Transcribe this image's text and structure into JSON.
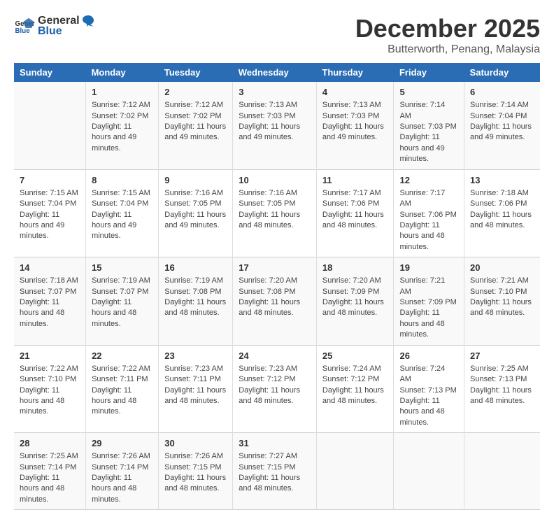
{
  "logo": {
    "general": "General",
    "blue": "Blue"
  },
  "title": "December 2025",
  "subtitle": "Butterworth, Penang, Malaysia",
  "headers": [
    "Sunday",
    "Monday",
    "Tuesday",
    "Wednesday",
    "Thursday",
    "Friday",
    "Saturday"
  ],
  "weeks": [
    [
      {
        "day": "",
        "info": ""
      },
      {
        "day": "1",
        "info": "Sunrise: 7:12 AM\nSunset: 7:02 PM\nDaylight: 11 hours and 49 minutes."
      },
      {
        "day": "2",
        "info": "Sunrise: 7:12 AM\nSunset: 7:02 PM\nDaylight: 11 hours and 49 minutes."
      },
      {
        "day": "3",
        "info": "Sunrise: 7:13 AM\nSunset: 7:03 PM\nDaylight: 11 hours and 49 minutes."
      },
      {
        "day": "4",
        "info": "Sunrise: 7:13 AM\nSunset: 7:03 PM\nDaylight: 11 hours and 49 minutes."
      },
      {
        "day": "5",
        "info": "Sunrise: 7:14 AM\nSunset: 7:03 PM\nDaylight: 11 hours and 49 minutes."
      },
      {
        "day": "6",
        "info": "Sunrise: 7:14 AM\nSunset: 7:04 PM\nDaylight: 11 hours and 49 minutes."
      }
    ],
    [
      {
        "day": "7",
        "info": "Sunrise: 7:15 AM\nSunset: 7:04 PM\nDaylight: 11 hours and 49 minutes."
      },
      {
        "day": "8",
        "info": "Sunrise: 7:15 AM\nSunset: 7:04 PM\nDaylight: 11 hours and 49 minutes."
      },
      {
        "day": "9",
        "info": "Sunrise: 7:16 AM\nSunset: 7:05 PM\nDaylight: 11 hours and 49 minutes."
      },
      {
        "day": "10",
        "info": "Sunrise: 7:16 AM\nSunset: 7:05 PM\nDaylight: 11 hours and 48 minutes."
      },
      {
        "day": "11",
        "info": "Sunrise: 7:17 AM\nSunset: 7:06 PM\nDaylight: 11 hours and 48 minutes."
      },
      {
        "day": "12",
        "info": "Sunrise: 7:17 AM\nSunset: 7:06 PM\nDaylight: 11 hours and 48 minutes."
      },
      {
        "day": "13",
        "info": "Sunrise: 7:18 AM\nSunset: 7:06 PM\nDaylight: 11 hours and 48 minutes."
      }
    ],
    [
      {
        "day": "14",
        "info": "Sunrise: 7:18 AM\nSunset: 7:07 PM\nDaylight: 11 hours and 48 minutes."
      },
      {
        "day": "15",
        "info": "Sunrise: 7:19 AM\nSunset: 7:07 PM\nDaylight: 11 hours and 48 minutes."
      },
      {
        "day": "16",
        "info": "Sunrise: 7:19 AM\nSunset: 7:08 PM\nDaylight: 11 hours and 48 minutes."
      },
      {
        "day": "17",
        "info": "Sunrise: 7:20 AM\nSunset: 7:08 PM\nDaylight: 11 hours and 48 minutes."
      },
      {
        "day": "18",
        "info": "Sunrise: 7:20 AM\nSunset: 7:09 PM\nDaylight: 11 hours and 48 minutes."
      },
      {
        "day": "19",
        "info": "Sunrise: 7:21 AM\nSunset: 7:09 PM\nDaylight: 11 hours and 48 minutes."
      },
      {
        "day": "20",
        "info": "Sunrise: 7:21 AM\nSunset: 7:10 PM\nDaylight: 11 hours and 48 minutes."
      }
    ],
    [
      {
        "day": "21",
        "info": "Sunrise: 7:22 AM\nSunset: 7:10 PM\nDaylight: 11 hours and 48 minutes."
      },
      {
        "day": "22",
        "info": "Sunrise: 7:22 AM\nSunset: 7:11 PM\nDaylight: 11 hours and 48 minutes."
      },
      {
        "day": "23",
        "info": "Sunrise: 7:23 AM\nSunset: 7:11 PM\nDaylight: 11 hours and 48 minutes."
      },
      {
        "day": "24",
        "info": "Sunrise: 7:23 AM\nSunset: 7:12 PM\nDaylight: 11 hours and 48 minutes."
      },
      {
        "day": "25",
        "info": "Sunrise: 7:24 AM\nSunset: 7:12 PM\nDaylight: 11 hours and 48 minutes."
      },
      {
        "day": "26",
        "info": "Sunrise: 7:24 AM\nSunset: 7:13 PM\nDaylight: 11 hours and 48 minutes."
      },
      {
        "day": "27",
        "info": "Sunrise: 7:25 AM\nSunset: 7:13 PM\nDaylight: 11 hours and 48 minutes."
      }
    ],
    [
      {
        "day": "28",
        "info": "Sunrise: 7:25 AM\nSunset: 7:14 PM\nDaylight: 11 hours and 48 minutes."
      },
      {
        "day": "29",
        "info": "Sunrise: 7:26 AM\nSunset: 7:14 PM\nDaylight: 11 hours and 48 minutes."
      },
      {
        "day": "30",
        "info": "Sunrise: 7:26 AM\nSunset: 7:15 PM\nDaylight: 11 hours and 48 minutes."
      },
      {
        "day": "31",
        "info": "Sunrise: 7:27 AM\nSunset: 7:15 PM\nDaylight: 11 hours and 48 minutes."
      },
      {
        "day": "",
        "info": ""
      },
      {
        "day": "",
        "info": ""
      },
      {
        "day": "",
        "info": ""
      }
    ]
  ]
}
